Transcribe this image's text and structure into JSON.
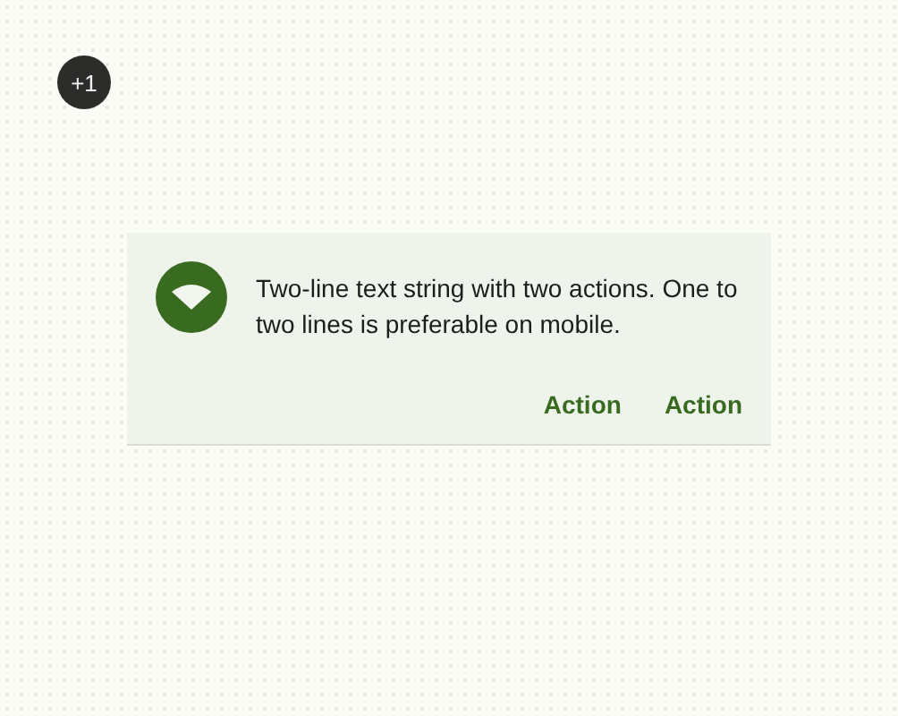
{
  "badge": {
    "text": "+1"
  },
  "banner": {
    "message": "Two-line text string with two actions. One to two lines is preferable on mobile.",
    "actions": [
      "Action",
      "Action"
    ]
  }
}
